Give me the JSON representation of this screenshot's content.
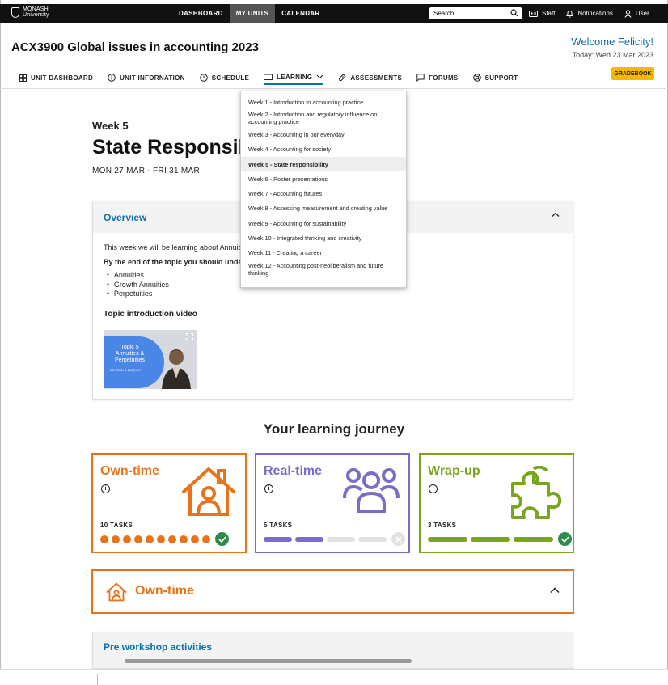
{
  "topbar": {
    "logo_line1": "MONASH",
    "logo_line2": "University",
    "nav": [
      {
        "label": "DASHBOARD",
        "active": false
      },
      {
        "label": "MY UNITS",
        "active": true
      },
      {
        "label": "CALENDAR",
        "active": false
      }
    ],
    "search_placeholder": "Search",
    "staff_label": "Staff",
    "notifications_label": "Notifications",
    "user_label": "User"
  },
  "unit": {
    "title": "ACX3900 Global issues in accounting 2023",
    "welcome": "Welcome Felicity!",
    "today": "Today: Wed 23 Mar 2023",
    "gradebook_label": "GRADEBOOK"
  },
  "unit_nav": [
    {
      "label": "UNIT DASHBOARD",
      "icon": "grid-icon"
    },
    {
      "label": "UNIT INFORNATION",
      "icon": "info-icon"
    },
    {
      "label": "SCHEDULE",
      "icon": "clock-icon"
    },
    {
      "label": "LEARNING",
      "icon": "book-icon",
      "active": true
    },
    {
      "label": "ASSESSMENTS",
      "icon": "assessment-icon"
    },
    {
      "label": "FORUMS",
      "icon": "chat-icon"
    },
    {
      "label": "SUPPORT",
      "icon": "lifebuoy-icon"
    }
  ],
  "week": {
    "number": "Week 5",
    "title": "State Responsibility",
    "dates": "MON 27 MAR - FRI 31 MAR"
  },
  "overview": {
    "heading": "Overview",
    "intro": "This week we will be learning about Annuities",
    "objectives_lead": "By the end of the topic you should understand",
    "topics": [
      "Annuities",
      "Growth Annuities",
      "Perpetuities"
    ],
    "video_heading": "Topic introduction video",
    "video_title": "Topic 5 Annuities & Perpetuities",
    "video_presenter": "BRYSON & BRENNY"
  },
  "learning_menu": [
    {
      "label": "Week 1 - Introduction to accounting practice"
    },
    {
      "label": "Week 2 - Introduction and regulatory influence on accounting practice"
    },
    {
      "label": "Week 3 - Accounting in our everyday"
    },
    {
      "label": "Week 4 - Accounting for society"
    },
    {
      "label": "Week 5 - State responsibility",
      "selected": true
    },
    {
      "label": "Week 6 - Poster presentations"
    },
    {
      "label": "Week 7 - Accounting futures"
    },
    {
      "label": "Week 8 - Assessing measurement and creating value"
    },
    {
      "label": "Week 9 - Accounting for sustainability"
    },
    {
      "label": "Week 10 - Integrated thinking and creativity"
    },
    {
      "label": "Week 11 - Creating a career"
    },
    {
      "label": "Week 12 - Accounting post-neoliberalism and future thinking"
    }
  ],
  "journey": {
    "title": "Your learning journey",
    "cards": [
      {
        "name": "Own-time",
        "tasks": "10 TASKS",
        "color": "#e8731a",
        "total": 10,
        "completed": 10,
        "complete": true
      },
      {
        "name": "Real-time",
        "tasks": "5 TASKS",
        "color": "#7b6cc9",
        "total": 4,
        "completed": 2,
        "complete": false
      },
      {
        "name": "Wrap-up",
        "tasks": "3 TASKS",
        "color": "#7aa51e",
        "total": 3,
        "completed": 3,
        "complete": true
      }
    ]
  },
  "sections": {
    "own_time": "Own-time",
    "pre_workshop": "Pre workshop activities"
  },
  "colors": {
    "accent_blue": "#0f6fa8",
    "gradebook_yellow": "#f5b800",
    "complete_green": "#2e8b4a"
  }
}
